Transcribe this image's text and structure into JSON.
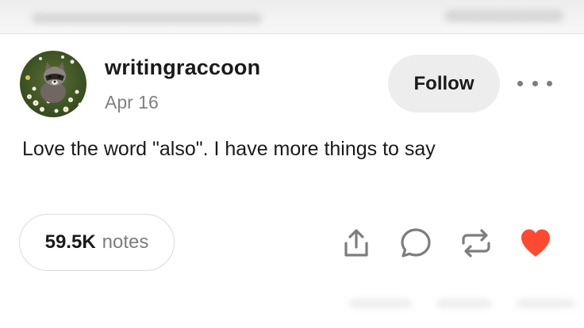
{
  "post": {
    "username": "writingraccoon",
    "date": "Apr 16",
    "text": "Love the word \"also\". I have more things to say",
    "follow_label": "Follow",
    "notes_count": "59.5K",
    "notes_label": "notes"
  },
  "icons": {
    "avatar": "raccoon-photo",
    "more": "ellipsis-icon",
    "share": "share-icon",
    "reply": "reply-icon",
    "reblog": "reblog-icon",
    "like": "heart-icon"
  },
  "colors": {
    "heart": "#ff4930",
    "icon_stroke": "#7d7d7d",
    "follow_bg": "#ededed"
  }
}
